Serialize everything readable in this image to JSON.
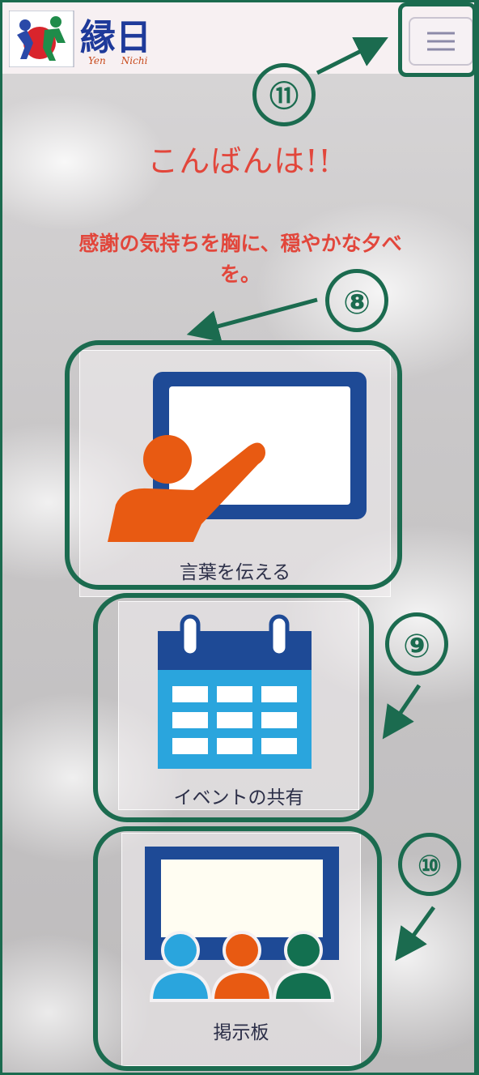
{
  "header": {
    "logo_text": "縁日",
    "logo_subtitle": "Yen Nichi",
    "menu_icon": "hamburger-icon"
  },
  "greeting": "こんばんは!!",
  "message_line1": "感謝の気持ちを胸に、穏やかな夕べ",
  "message_line2": "を。",
  "cards": [
    {
      "label": "言葉を伝える",
      "icon": "teacher-board-icon"
    },
    {
      "label": "イベントの共有",
      "icon": "calendar-icon"
    },
    {
      "label": "掲示板",
      "icon": "bulletin-board-icon"
    }
  ],
  "callouts": {
    "menu": "⑪",
    "card_1": "⑧",
    "card_2": "⑨",
    "card_3": "⑩"
  },
  "colors": {
    "accent_green": "#1b6b4f",
    "greeting_red": "#e2463b",
    "icon_blue": "#1e4a96",
    "icon_orange": "#e85a12",
    "icon_light_blue": "#2aa5dd",
    "icon_dark_green": "#137050"
  }
}
